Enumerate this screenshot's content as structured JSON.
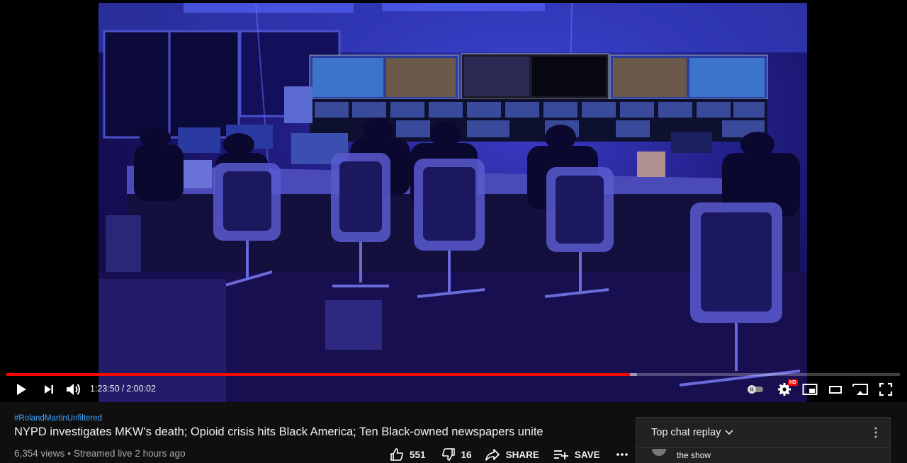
{
  "player": {
    "current_time": "1:23:50",
    "time_separator": "/",
    "duration": "2:00:02",
    "progress_fraction": 0.698,
    "buffered_fraction": 0.706,
    "hd_badge": "HD",
    "colors": {
      "played": "#ff0000",
      "accent": "#3ea6ff"
    }
  },
  "video": {
    "hashtag": "#RolandMartinUnfiltered",
    "title": "NYPD investigates MKW's death; Opioid crisis hits Black America; Ten Black-owned newspapers unite",
    "views": "6,354 views",
    "separator": "•",
    "streamed": "Streamed live 2 hours ago"
  },
  "actions": {
    "likes": "551",
    "dislikes": "16",
    "share_label": "SHARE",
    "save_label": "SAVE"
  },
  "chat": {
    "title": "Top chat replay",
    "partial_message": "the show"
  },
  "icons": {
    "play": "play-icon",
    "next": "skip-next-icon",
    "volume": "volume-icon",
    "autoplay": "autoplay-toggle",
    "settings": "gear-icon",
    "miniplayer": "miniplayer-icon",
    "theater": "theater-mode-icon",
    "cast": "cast-icon",
    "fullscreen": "fullscreen-icon",
    "like": "thumbs-up-icon",
    "dislike": "thumbs-down-icon",
    "share": "share-arrow-icon",
    "save": "playlist-add-icon",
    "more": "more-horizontal-icon"
  }
}
